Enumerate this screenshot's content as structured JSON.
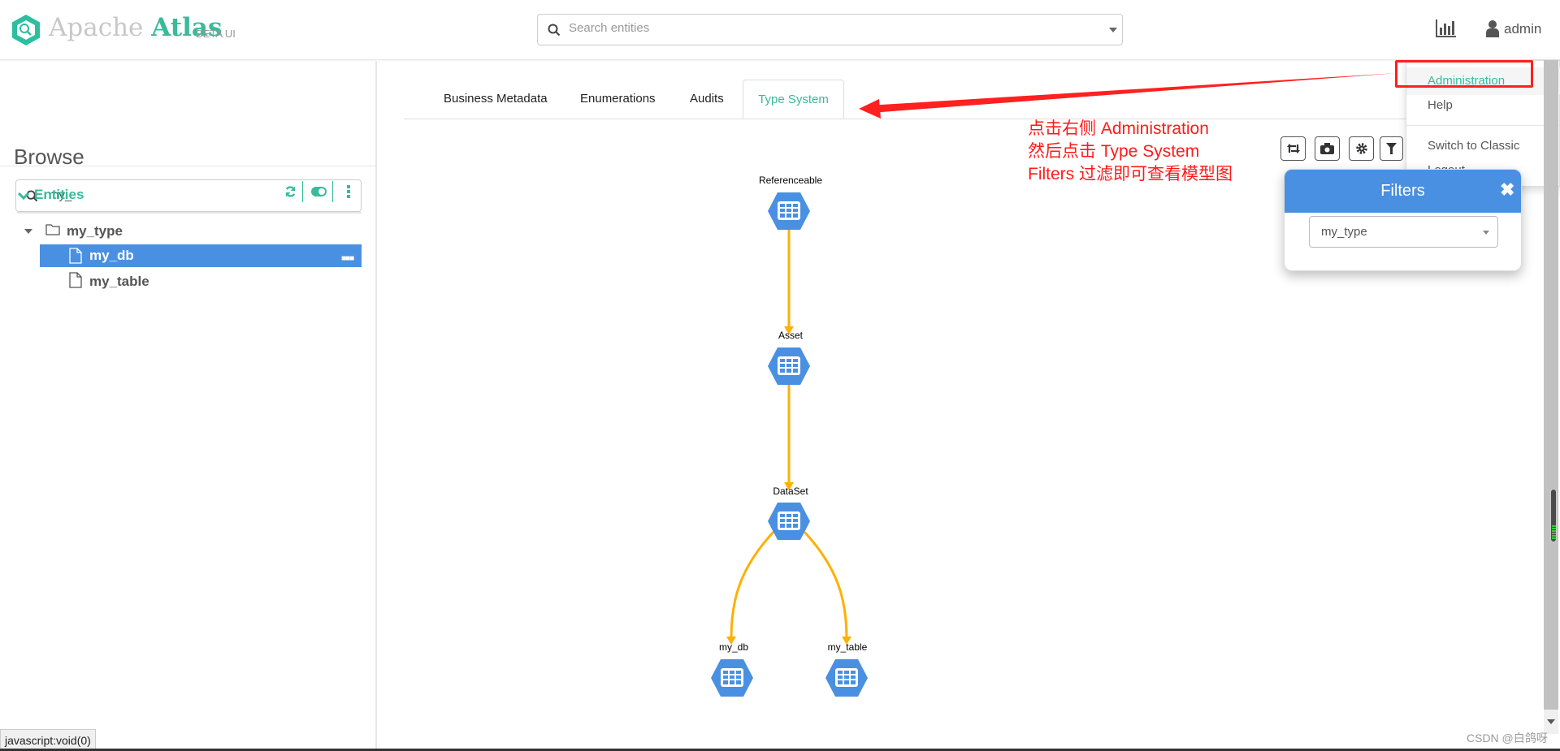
{
  "header": {
    "logo_text_a": "Apache ",
    "logo_text_b": "Atlas",
    "logo_beta": "BETA UI",
    "search_placeholder": "Search entities",
    "user": "admin",
    "icons": [
      "logo-hexagon-icon",
      "search-icon",
      "bar-chart-icon",
      "user-icon"
    ]
  },
  "sidebar": {
    "title": "Browse",
    "search_value": "my_",
    "section": "Entities",
    "tree": {
      "folder": "my_type",
      "items": [
        {
          "label": "my_db",
          "selected": true
        },
        {
          "label": "my_table",
          "selected": false
        }
      ]
    }
  },
  "tabs": [
    {
      "label": "Business Metadata"
    },
    {
      "label": "Enumerations"
    },
    {
      "label": "Audits"
    },
    {
      "label": "Type System",
      "active": true
    }
  ],
  "user_menu": {
    "items": [
      "Administration",
      "Help",
      "Switch to Classic",
      "Logout"
    ]
  },
  "filters": {
    "title": "Filters",
    "selected": "my_type"
  },
  "annotation": {
    "lines": [
      "点击右侧 Administration",
      "然后点击 Type System",
      "Filters 过滤即可查看模型图"
    ],
    "color": "#ff1a1a"
  },
  "graph": {
    "nodes": [
      "Referenceable",
      "Asset",
      "DataSet",
      "my_db",
      "my_table"
    ],
    "edges": [
      [
        "Referenceable",
        "Asset"
      ],
      [
        "Asset",
        "DataSet"
      ],
      [
        "DataSet",
        "my_db"
      ],
      [
        "DataSet",
        "my_table"
      ]
    ],
    "node_color": "#4a90e2",
    "edge_color": "#ffb000"
  },
  "status_bar": "javascript:void(0)",
  "watermark": "CSDN @白鸽呀",
  "colors": {
    "accent": "#37bb9b",
    "selected": "#4a90e2"
  }
}
